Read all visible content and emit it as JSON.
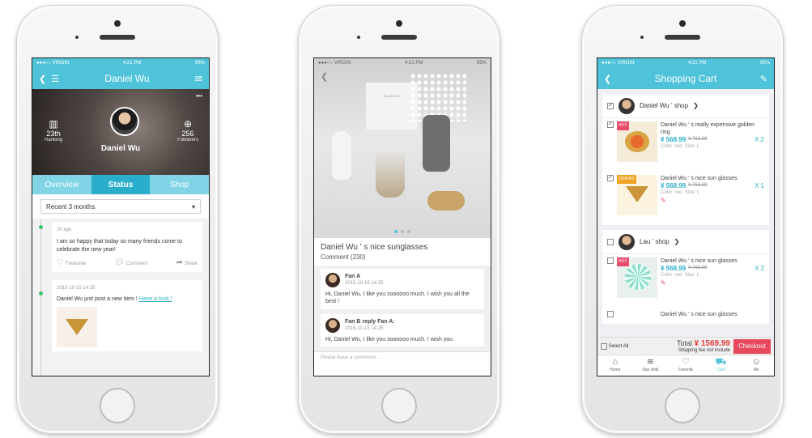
{
  "status": {
    "carrier": "●●●○○ VIRGIN",
    "time": "4:21 PM",
    "battery": "95%"
  },
  "s1": {
    "title": "Daniel Wu",
    "profile_name": "Daniel Wu",
    "ranking_value": "23th",
    "ranking_label": "Ranking",
    "followers_value": "256",
    "followers_label": "Followers",
    "more": "•••",
    "tabs": [
      "Overview",
      "Status",
      "Shop"
    ],
    "filter": "Recent 3 months",
    "post1": {
      "time": "2h ago",
      "text": "I am so happy that today so many friends come to celebrate the new year!",
      "fav": "Favourite",
      "comment": "Comment",
      "share": "Share"
    },
    "post2": {
      "time": "2015-10-15  14:25",
      "text": "Daniel Wu just post a new item ! ",
      "link": "Have a look !"
    }
  },
  "s2": {
    "box_text": "BLANCHE",
    "title": "Daniel Wu ' s nice sunglasses",
    "comment_count": "Comment (230)",
    "comments": [
      {
        "name": "Fan A",
        "time": "2015-10-15  14:25",
        "text": "Hi, Daniel Wu, I like you soooooo much. I wish you all the best !"
      },
      {
        "name": "Fan B reply Fan A:",
        "time": "2015-10-15  14:25",
        "text": "Hi, Daniel Wu, I like you soooooo much. I wish you"
      }
    ],
    "input_placeholder": "Please leave a comments . . ."
  },
  "s3": {
    "title": "Shopping Cart",
    "shop1": {
      "name": "Daniel Wu ' shop"
    },
    "item1": {
      "tag": "HOT",
      "name": "Daniel Wu ' s really expensive golden ring",
      "price": "¥ 568.99",
      "old": "¥ 768.99",
      "qty": "X  2",
      "color": "Color: red",
      "size": "Size: L"
    },
    "item2": {
      "tag": "20%OFF",
      "name": "Daniel Wu ' s nice sun glasses",
      "price": "¥ 568.99",
      "old": "¥ 768.99",
      "qty": "X  1",
      "color": "Color: red",
      "size": "Size: L"
    },
    "shop2": {
      "name": "Lau ' shop"
    },
    "item3": {
      "tag": "HOT",
      "name": "Daniel Wu ' s nice sun glasses",
      "price": "¥ 568.99",
      "old": "¥ 768.99",
      "qty": "X  2",
      "color": "Color: red",
      "size": "Size: L"
    },
    "item4": {
      "name": "Daniel Wu ' s nice sun glasses"
    },
    "select_all": "Select All",
    "total_label": "Total",
    "total": "¥ 1569.99",
    "shipping": "Shipping fee not include",
    "checkout": "Checkout",
    "tabbar": [
      "Home",
      "Star Wall",
      "Favorite",
      "Cart",
      "Me"
    ]
  },
  "colors": {
    "accent": "#4ec3d9",
    "checkout": "#e8485c",
    "tag_hot": "#e84b6a"
  }
}
